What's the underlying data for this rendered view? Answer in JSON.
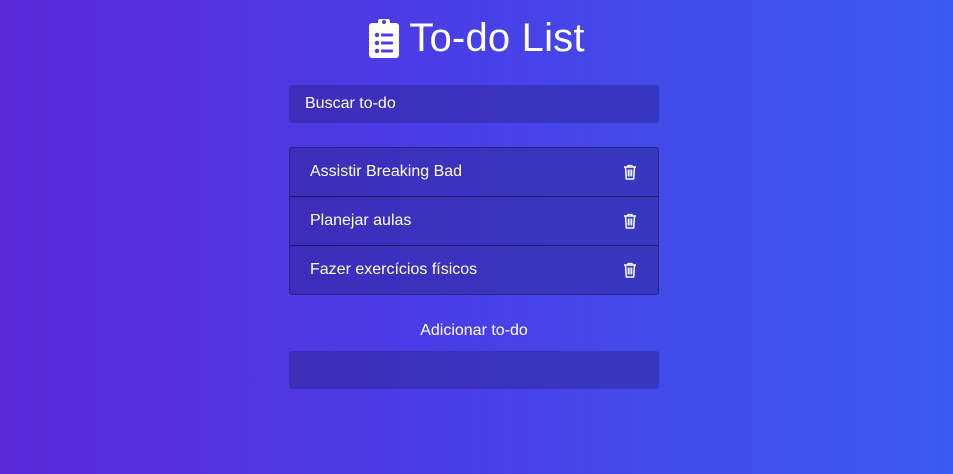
{
  "app": {
    "title": "To-do List",
    "icon": "clipboard-list-icon"
  },
  "search": {
    "placeholder": "Buscar to-do",
    "value": ""
  },
  "todos": [
    {
      "text": "Assistir Breaking Bad",
      "delete_icon": "trash-icon"
    },
    {
      "text": "Planejar aulas",
      "delete_icon": "trash-icon"
    },
    {
      "text": "Fazer exercícios físicos",
      "delete_icon": "trash-icon"
    }
  ],
  "add": {
    "label": "Adicionar to-do",
    "value": ""
  },
  "colors": {
    "gradient_start": "#5a29d6",
    "gradient_end": "#3a5bef",
    "text": "#ffffff"
  }
}
